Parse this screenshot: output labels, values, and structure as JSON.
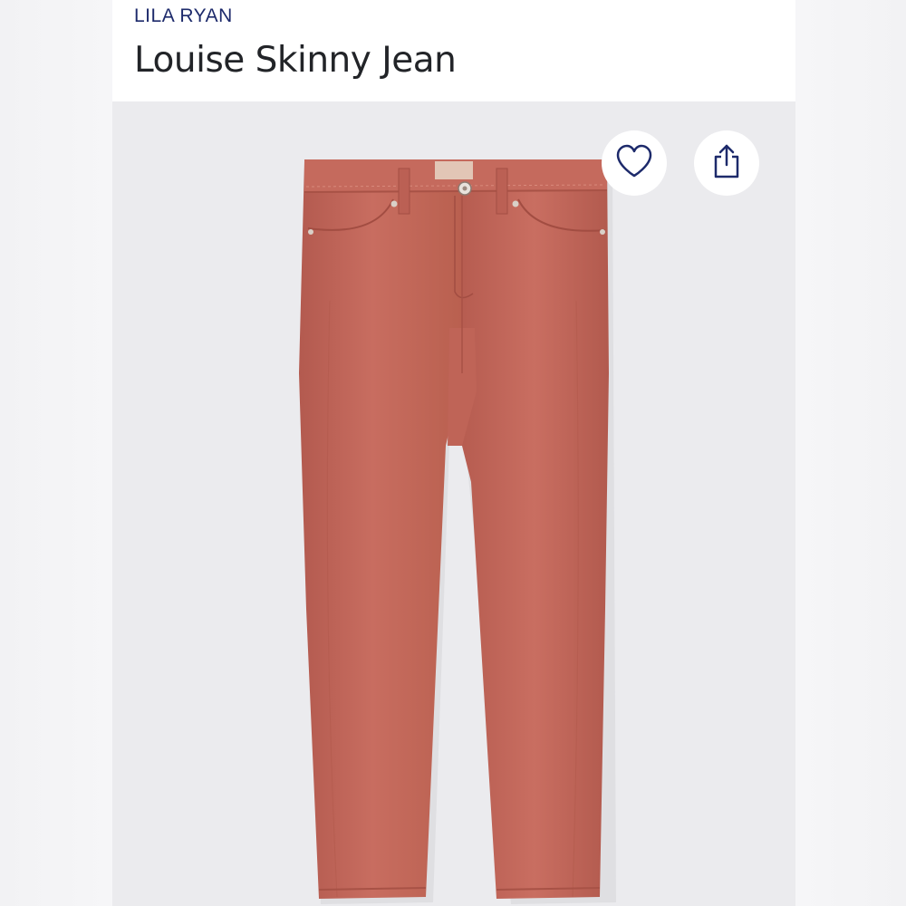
{
  "product": {
    "brand": "LILA RYAN",
    "title": "Louise Skinny Jean"
  },
  "actions": {
    "favorite_icon": "heart-icon",
    "share_icon": "share-icon"
  },
  "colors": {
    "brand_text": "#1d2a6b",
    "title_text": "#222428",
    "denim": "#c2675b",
    "photo_background": "#ebebee"
  }
}
